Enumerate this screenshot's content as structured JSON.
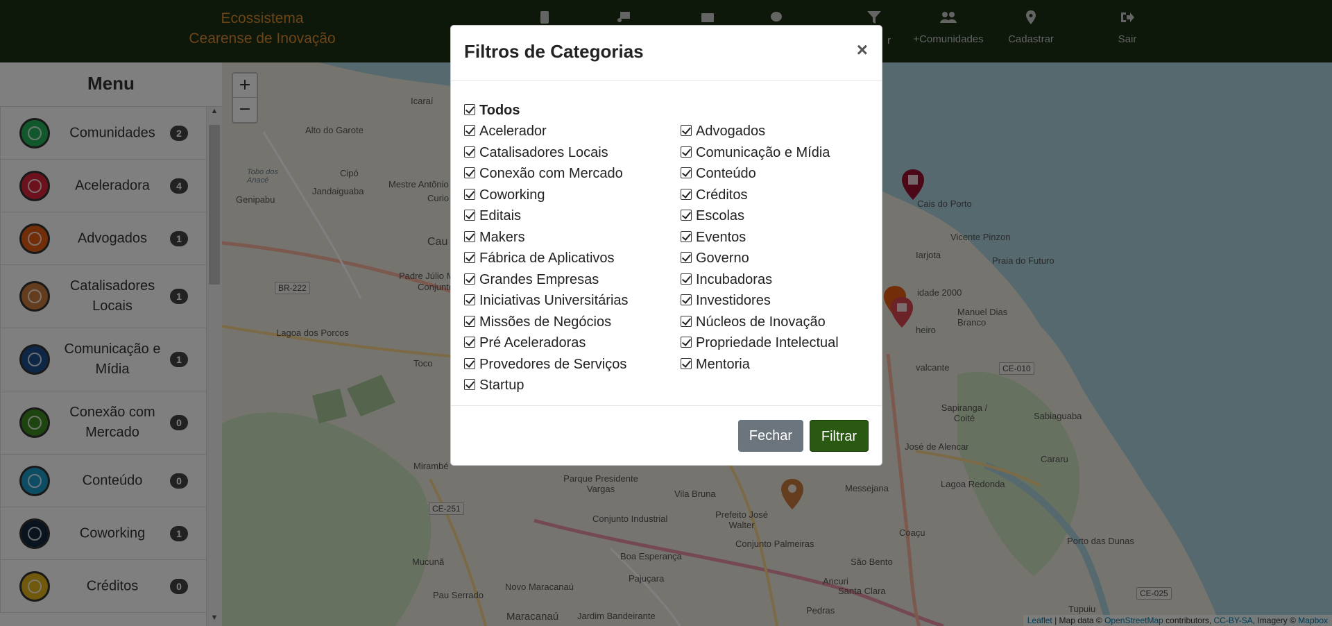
{
  "brand": {
    "line1": "Ecossistema",
    "line2": "Cearense de Inovação"
  },
  "nav": {
    "filter_partial_label": "r",
    "comunidades_label": "+Comunidades",
    "cadastrar_label": "Cadastrar",
    "sair_label": "Sair"
  },
  "sidebar": {
    "title": "Menu",
    "items": [
      {
        "label": "Comunidades",
        "count": "2",
        "color": "#22b35a"
      },
      {
        "label": "Aceleradora",
        "count": "4",
        "color": "#d6243a"
      },
      {
        "label": "Advogados",
        "count": "1",
        "color": "#e35c12"
      },
      {
        "label": "Catalisadores Locais",
        "count": "1",
        "color": "#c97a3c"
      },
      {
        "label": "Comunicação e Mídia",
        "count": "1",
        "color": "#1f4f8f"
      },
      {
        "label": "Conexão com Mercado",
        "count": "0",
        "color": "#3d8a1e"
      },
      {
        "label": "Conteúdo",
        "count": "0",
        "color": "#1b9ac9"
      },
      {
        "label": "Coworking",
        "count": "1",
        "color": "#12283d"
      },
      {
        "label": "Créditos",
        "count": "0",
        "color": "#e0b21a"
      }
    ]
  },
  "map": {
    "zoom_in": "+",
    "zoom_out": "−",
    "labels": [
      "Icaraí",
      "Alto do Garote",
      "Cipó",
      "Genipabu",
      "Jandaiguaba",
      "Padre Júlio Maria",
      "Mestre Antônio",
      "Curio",
      "Conjunto Me",
      "Lagoa dos Porcos",
      "Toco",
      "Cais do Porto",
      "Vicente Pinzon",
      "Praia do Futuro",
      "Manuel Dias Branco",
      "Sapiranga / Coité",
      "Sabiaguaba",
      "José de Alencar",
      "Lagoa Redonda",
      "Messejana",
      "Cararu",
      "Parque Presidente Vargas",
      "Conjunto Industrial",
      "Vila Bruna",
      "Prefeito José Walter",
      "Conjunto Palmeiras",
      "Coaçu",
      "Porto das Dunas",
      "Mucunã",
      "Boa Esperança",
      "Pajuçara",
      "São Bento",
      "Novo Maracanaú",
      "Ancuri",
      "Santa Clara",
      "Pau Serrado",
      "Jardim Bandeirante",
      "Pedras",
      "Tupuiu",
      "Maracanaú",
      "Mirambé",
      "Cau",
      "Iarjota",
      "idade 2000",
      "heiro",
      "valcante"
    ],
    "water_labels": [
      "Tobo dos Anacé"
    ],
    "shields": [
      "BR-222",
      "CE-010",
      "CE-251",
      "CE-025"
    ],
    "attribution": {
      "leaflet": "Leaflet",
      "text1": " | Map data © ",
      "osm": "OpenStreetMap",
      "text2": " contributors, ",
      "cc": "CC-BY-SA",
      "text3": ", Imagery © ",
      "mapbox": "Mapbox"
    }
  },
  "modal": {
    "title": "Filtros de Categorias",
    "close": "×",
    "todos": "Todos",
    "left_column": [
      "Acelerador",
      "Catalisadores Locais",
      "Conexão com Mercado",
      "Coworking",
      "Editais",
      "Makers",
      "Fábrica de Aplicativos",
      "Grandes Empresas",
      "Iniciativas Universitárias",
      "Missões de Negócios",
      "Pré Aceleradoras",
      "Provedores de Serviços",
      "Startup"
    ],
    "right_column": [
      "Advogados",
      "Comunicação e Mídia",
      "Conteúdo",
      "Créditos",
      "Escolas",
      "Eventos",
      "Governo",
      "Incubadoras",
      "Investidores",
      "Núcleos de Inovação",
      "Propriedade Intelectual",
      "Mentoria"
    ],
    "checked": true,
    "fechar": "Fechar",
    "filtrar": "Filtrar"
  }
}
